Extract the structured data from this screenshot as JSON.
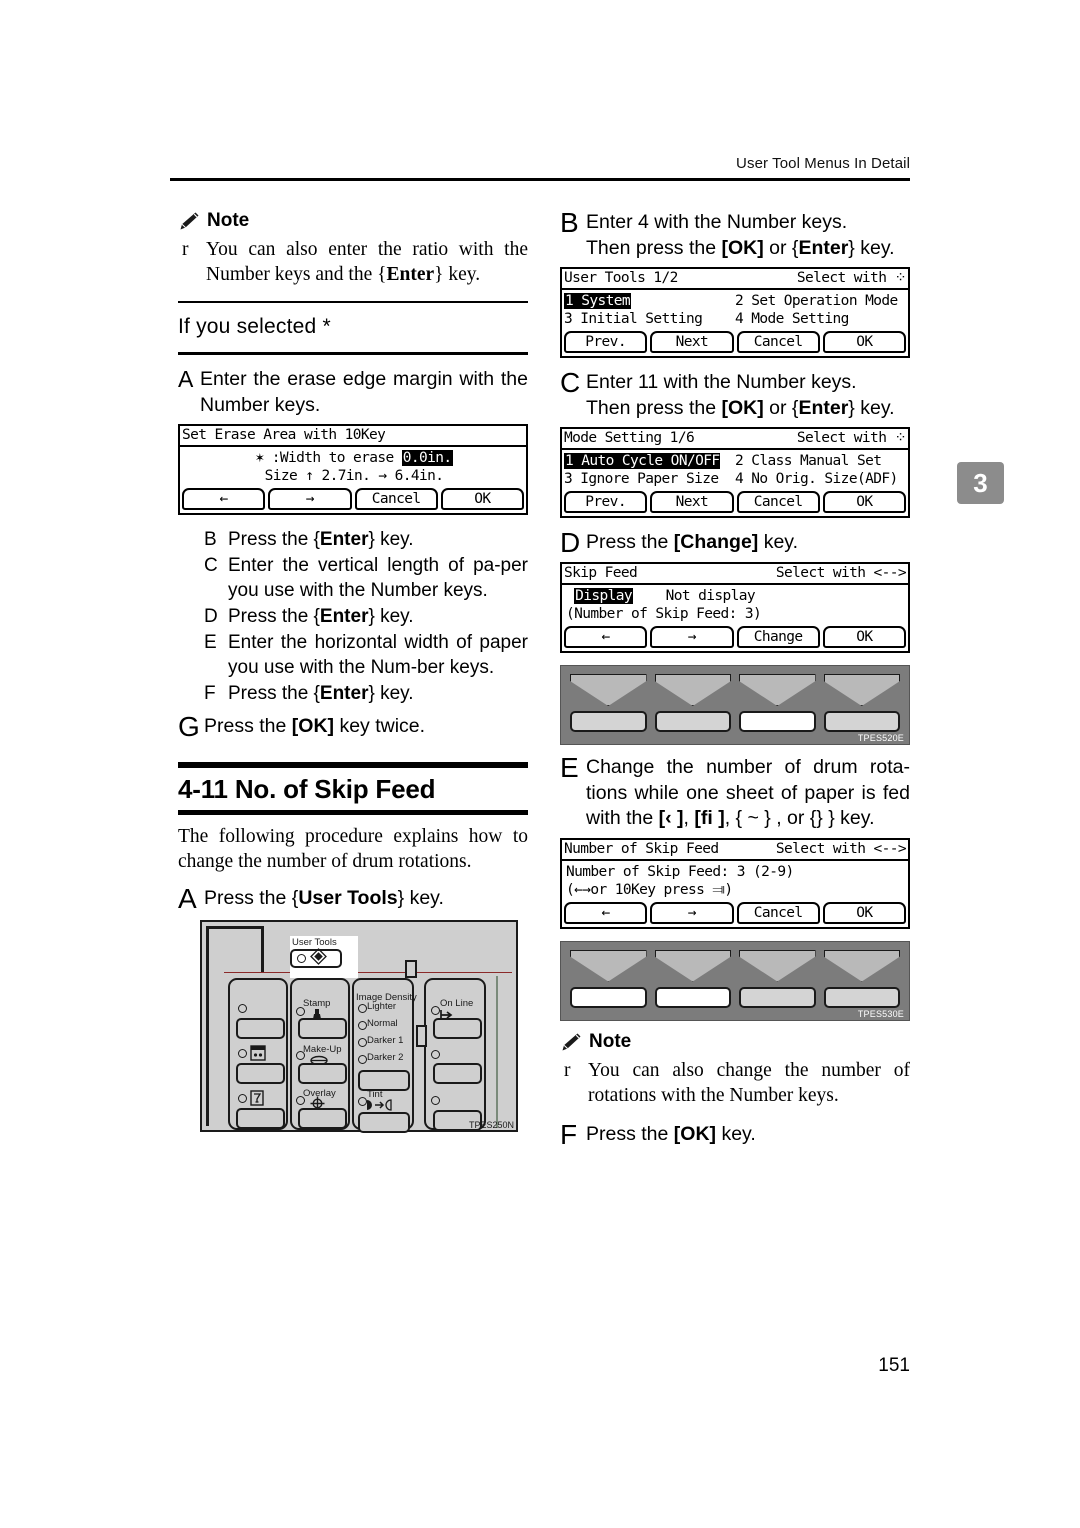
{
  "header": {
    "running_title": "User Tool Menus In Detail",
    "chapter_tab": "3"
  },
  "page_number": "151",
  "left_column": {
    "note1": {
      "icon": "pencil-icon",
      "title": "Note",
      "bullet": "r",
      "text": "You can also enter the ratio with the Number keys and the {Enter} key."
    },
    "subheading": "If you selected *",
    "step_a": {
      "letter": "A",
      "text": "Enter the erase edge margin with the Number keys."
    },
    "lcd_erase": {
      "title_left": "Set Erase Area with 10Key",
      "title_right": "",
      "line1_prefix": "✶  :Width to erase ",
      "line1_value": "0.0in.",
      "line2": "Size ↑ 2.7in. → 6.4in.",
      "buttons": [
        "←",
        "→",
        "Cancel",
        "OK"
      ]
    },
    "steps": [
      {
        "letter": "B",
        "text": "Press the {Enter} key."
      },
      {
        "letter": "C",
        "text": "Enter the vertical length of pa-per you use with the Number keys."
      },
      {
        "letter": "D",
        "text": "Press the {Enter} key."
      },
      {
        "letter": "E",
        "text": "Enter the horizontal width of paper you use with the Num-ber keys."
      },
      {
        "letter": "F",
        "text": "Press the {Enter} key."
      }
    ],
    "step_g": {
      "letter": "G",
      "text": "Press the [OK] key twice."
    },
    "section": {
      "title": "4-11 No. of Skip Feed",
      "paragraph": "The following procedure explains how to change the number of drum rotations."
    },
    "step_a2": {
      "letter": "A",
      "text": "Press the {User Tools} key."
    },
    "control_panel": {
      "code": "TPES250N",
      "user_tools_label": "User Tools",
      "labels": [
        "Stamp",
        "Make-Up",
        "Overlay",
        "Image Density",
        "Lighter",
        "Normal",
        "Darker 1",
        "Darker 2",
        "Tint",
        "On Line"
      ]
    }
  },
  "right_column": {
    "step_b": {
      "letter": "B",
      "line1": "Enter 4 with the Number keys.",
      "line2": "Then press the [OK] or {Enter} key."
    },
    "lcd_usertools": {
      "title_left": "User Tools 1/2",
      "title_right": "Select with ⁘",
      "row1_c1": "1 System",
      "row1_c1_inverted": true,
      "row1_c2": "2 Set Operation Mode",
      "row2_c1": "3 Initial Setting",
      "row2_c2": "4 Mode Setting",
      "buttons": [
        "Prev.",
        "Next",
        "Cancel",
        "OK"
      ]
    },
    "step_c": {
      "letter": "C",
      "line1": "Enter 11 with the Number keys.",
      "line2": "Then press the [OK] or {Enter} key."
    },
    "lcd_modesetting": {
      "title_left": "Mode Setting 1/6",
      "title_right": "Select with ⁘",
      "row1_c1": "1 Auto Cycle ON/OFF",
      "row1_c1_inverted": true,
      "row1_c2": "2 Class Manual Set",
      "row2_c1": "3 Ignore Paper Size",
      "row2_c2": "4 No Orig. Size(ADF)",
      "buttons": [
        "Prev.",
        "Next",
        "Cancel",
        "OK"
      ]
    },
    "step_d": {
      "letter": "D",
      "text": "Press the [Change] key."
    },
    "lcd_skipfeed": {
      "title_left": "Skip Feed",
      "title_right": "Select with <-->",
      "row1_selected": "Display",
      "row1_other": "Not display",
      "row2": "(Number of Skip Feed: 3)",
      "buttons": [
        "←",
        "→",
        "Change",
        "OK"
      ]
    },
    "keybar1": {
      "code": "TPES520E",
      "highlighted_index": 2
    },
    "step_e": {
      "letter": "E",
      "text": "Change the number of drum rota-tions while one sheet of paper is fed with the [‹ ], [fi ], {~}, or {} } key."
    },
    "lcd_numskipfeed": {
      "title_left": "Number of Skip Feed",
      "title_right": "Select with <-->",
      "row1": "Number of Skip Feed: 3 (2-9)",
      "row2": " (←→or 10Key press ⫥)",
      "buttons": [
        "←",
        "→",
        "Cancel",
        "OK"
      ]
    },
    "keybar2": {
      "code": "TPES530E",
      "highlighted_index": 0
    },
    "note2": {
      "icon": "pencil-icon",
      "title": "Note",
      "bullet": "r",
      "text": "You can also change the number of rotations with the Number keys."
    },
    "step_f": {
      "letter": "F",
      "text": "Press the [OK] key."
    }
  }
}
